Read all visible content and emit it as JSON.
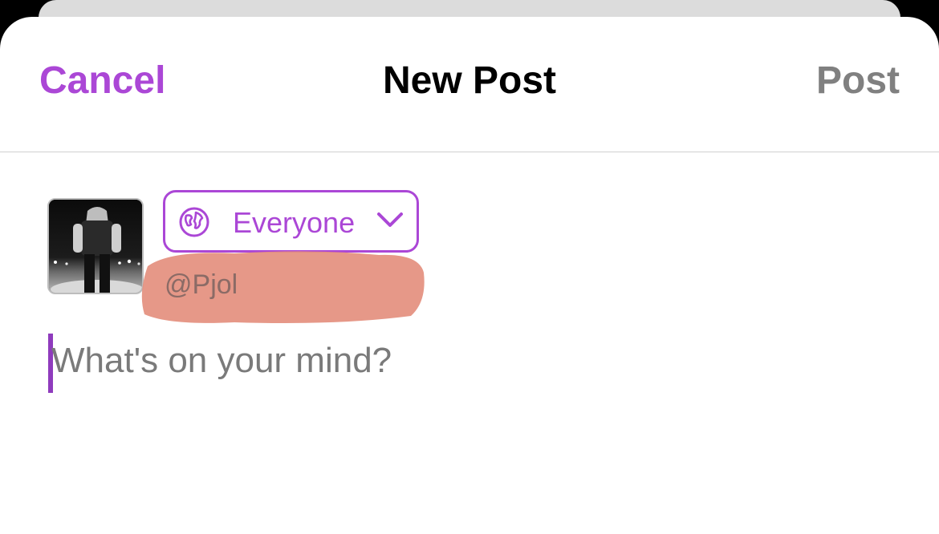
{
  "nav": {
    "cancel_label": "Cancel",
    "title": "New Post",
    "post_label": "Post"
  },
  "composer": {
    "audience_selected": "Everyone",
    "handle": "@Pjol",
    "placeholder": "What's on your mind?"
  },
  "icons": {
    "audience": "globe-icon",
    "audience_dropdown": "chevron-down-icon"
  },
  "colors": {
    "accent": "#ab47d6",
    "post_disabled": "#808080",
    "redaction": "#e48f7e",
    "placeholder": "#7a7a7a"
  }
}
